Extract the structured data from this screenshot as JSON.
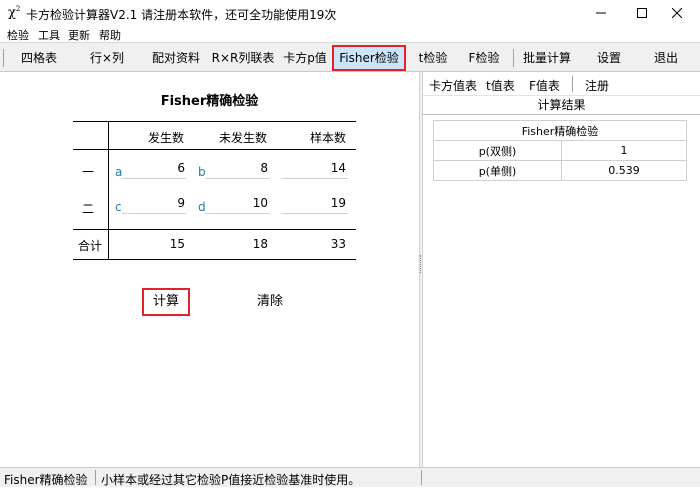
{
  "window": {
    "app_icon_main": "χ",
    "app_icon_sup": "2",
    "title": "卡方检验计算器V2.1    请注册本软件，还可全功能使用19次"
  },
  "menu": [
    "检验",
    "工具",
    "更新",
    "帮助"
  ],
  "toolbar": {
    "four_fold": "四格表",
    "row_col": "行×列",
    "paired": "配对资料",
    "rxr": "R×R列联表",
    "chi_p": "卡方p值",
    "fisher": "Fisher检验",
    "t_test": "t检验",
    "f_test": "F检验",
    "batch": "批量计算",
    "settings": "设置",
    "exit": "退出"
  },
  "fisher": {
    "title": "Fisher精确检验",
    "headers": [
      "发生数",
      "未发生数",
      "样本数"
    ],
    "rows": [
      {
        "label": "一",
        "a_letter": "a",
        "a": "6",
        "b_letter": "b",
        "b": "8",
        "total": "14"
      },
      {
        "label": "二",
        "a_letter": "c",
        "a": "9",
        "b_letter": "d",
        "b": "10",
        "total": "19"
      }
    ],
    "total_row": {
      "label": "合计",
      "col1": "15",
      "col2": "18",
      "col3": "33"
    },
    "calc_label": "计算",
    "clear_label": "清除"
  },
  "right": {
    "buttons": [
      "卡方值表",
      "t值表",
      "F值表",
      "注册"
    ],
    "result_header": "计算结果",
    "table_title": "Fisher精确检验",
    "rows": [
      {
        "label": "p(双侧)",
        "value": "1"
      },
      {
        "label": "p(单侧)",
        "value": "0.539"
      }
    ]
  },
  "status": {
    "left": "Fisher精确检验",
    "right": "小样本或经过其它检验P值接近检验基准时使用。"
  },
  "colors": {
    "highlight_border": "#e3212b",
    "selected_bg": "#cce4f7",
    "letter": "#1a7fa8"
  }
}
